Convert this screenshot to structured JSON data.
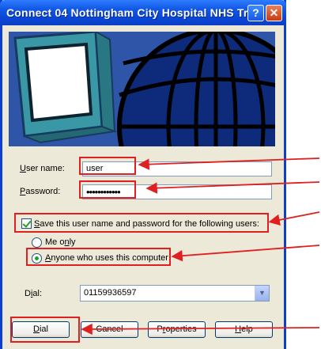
{
  "window": {
    "title": "Connect 04 Nottingham City Hospital NHS Tr...",
    "help_button": "?",
    "close_button": "✕"
  },
  "form": {
    "username_label_prefix": "",
    "username_label_accel": "U",
    "username_label_rest": "ser name:",
    "username_value": "user",
    "password_label_accel": "P",
    "password_label_rest": "assword:",
    "password_value": "••••••••••••",
    "save_checkbox_accel": "S",
    "save_checkbox_rest": "ave this user name and password for the following users:",
    "save_checked": true,
    "radio_me_only_accel": "n",
    "radio_me_only_pre": "Me o",
    "radio_me_only_post": "ly",
    "radio_anyone_accel": "A",
    "radio_anyone_rest": "nyone who uses this computer",
    "selected_radio": "anyone",
    "dial_label_pre": "D",
    "dial_label_accel": "i",
    "dial_label_post": "al:",
    "dial_value": "01159936597"
  },
  "buttons": {
    "dial_accel": "D",
    "dial_rest": "ial",
    "cancel": "Cancel",
    "properties_pre": "P",
    "properties_accel": "r",
    "properties_post": "operties",
    "help_accel": "H",
    "help_rest": "elp"
  },
  "colors": {
    "titlebar": "#0a47d8",
    "annotation": "#e02020",
    "dialog_bg": "#ece9d8"
  }
}
